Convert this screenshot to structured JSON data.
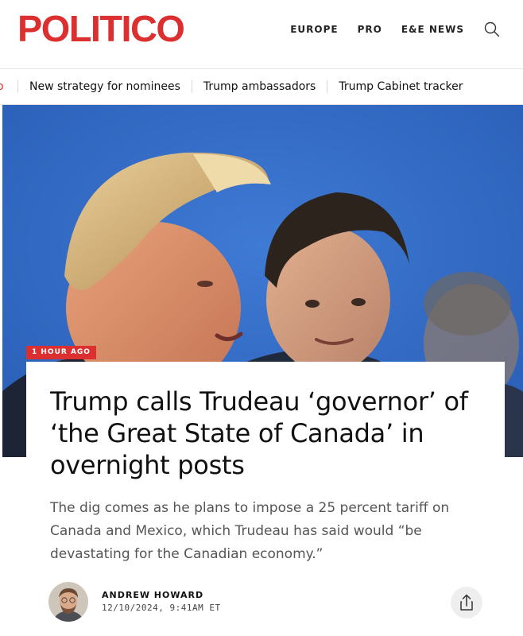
{
  "header": {
    "logo_text": "POLITICO",
    "nav": [
      "EUROPE",
      "PRO",
      "E&E NEWS"
    ],
    "search_icon": "search-icon"
  },
  "subnav": {
    "items": [
      "o",
      "New strategy for nominees",
      "Trump ambassadors",
      "Trump Cabinet tracker"
    ]
  },
  "colors": {
    "brand": "#dc2f2f",
    "hero_background": "#2f6cc9"
  },
  "article": {
    "time_badge": "1 HOUR AGO",
    "headline": "Trump calls Trudeau ‘governor’ of ‘the Great State of Canada’ in overnight posts",
    "dek": "The dig comes as he plans to impose a 25 percent tariff on Canada and Mexico, which Trudeau has said would “be devastating for the Canadian economy.”",
    "author": "ANDREW HOWARD",
    "date": "12/10/2024, 9:41AM ET",
    "share_icon": "share-icon"
  }
}
